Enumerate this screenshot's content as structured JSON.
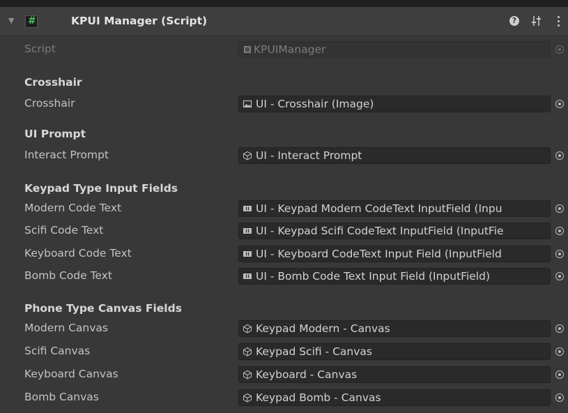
{
  "header": {
    "title": "KPUI Manager (Script)",
    "help_glyph": "?",
    "icons": {
      "collapse": "triangle-down-icon",
      "script": "cs-script-icon",
      "help": "help-icon",
      "presets": "sliders-icon",
      "menu": "kebab-menu-icon"
    },
    "accent_color": "#4ec35a"
  },
  "script_row": {
    "label": "Script",
    "value": "KPUIManager",
    "icon": "script-file-icon"
  },
  "sections": [
    {
      "title": "Crosshair",
      "rows": [
        {
          "label": "Crosshair",
          "value": "UI - Crosshair (Image)",
          "icon": "image-icon"
        }
      ]
    },
    {
      "title": "UI Prompt",
      "rows": [
        {
          "label": "Interact Prompt",
          "value": "UI - Interact Prompt",
          "icon": "gameobject-icon"
        }
      ]
    },
    {
      "title": "Keypad Type Input Fields",
      "rows": [
        {
          "label": "Modern Code Text",
          "value": "UI - Keypad Modern CodeText InputField (Inpu",
          "icon": "inputfield-icon"
        },
        {
          "label": "Scifi Code Text",
          "value": "UI - Keypad Scifi CodeText InputField (InputFie",
          "icon": "inputfield-icon"
        },
        {
          "label": "Keyboard Code Text",
          "value": "UI - Keyboard CodeText Input Field (InputField",
          "icon": "inputfield-icon"
        },
        {
          "label": "Bomb Code Text",
          "value": "UI - Bomb Code Text Input Field (InputField)",
          "icon": "inputfield-icon"
        }
      ]
    },
    {
      "title": "Phone Type Canvas Fields",
      "rows": [
        {
          "label": "Modern Canvas",
          "value": "Keypad Modern - Canvas",
          "icon": "gameobject-icon"
        },
        {
          "label": "Scifi Canvas",
          "value": "Keypad Scifi - Canvas",
          "icon": "gameobject-icon"
        },
        {
          "label": "Keyboard Canvas",
          "value": "Keyboard - Canvas",
          "icon": "gameobject-icon"
        },
        {
          "label": "Bomb Canvas",
          "value": "Keypad Bomb - Canvas",
          "icon": "gameobject-icon"
        }
      ]
    }
  ]
}
